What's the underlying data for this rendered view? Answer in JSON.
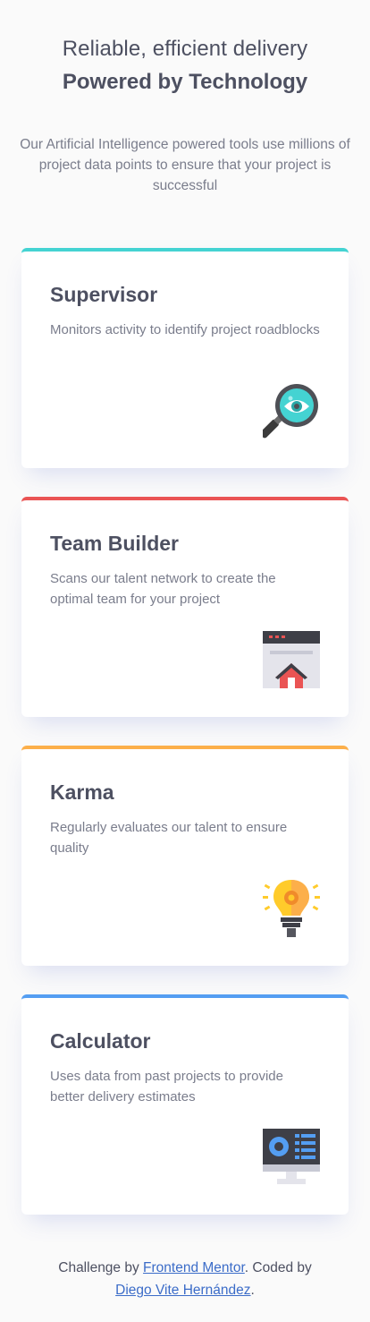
{
  "header": {
    "line1": "Reliable, efficient delivery",
    "line2": "Powered by Technology",
    "description": "Our Artificial Intelligence powered tools use millions of project data points to ensure that your project is successful"
  },
  "cards": [
    {
      "title": "Supervisor",
      "text": "Monitors activity to identify project roadblocks",
      "accent": "#44d3d2",
      "icon": "magnifier-eye-icon"
    },
    {
      "title": "Team Builder",
      "text": "Scans our talent network to create the optimal team for your project",
      "accent": "#ea5454",
      "icon": "browser-house-icon"
    },
    {
      "title": "Karma",
      "text": "Regularly evaluates our talent to ensure quality",
      "accent": "#fcaf4a",
      "icon": "lightbulb-gear-icon"
    },
    {
      "title": "Calculator",
      "text": "Uses data from past projects to provide better delivery estimates",
      "accent": "#549ef2",
      "icon": "monitor-dashboard-icon"
    }
  ],
  "footer": {
    "prefix": "Challenge by",
    "link1": "Frontend Mentor",
    "middle": ". Coded by",
    "link2": "Diego Vite Hernández",
    "suffix": "."
  }
}
